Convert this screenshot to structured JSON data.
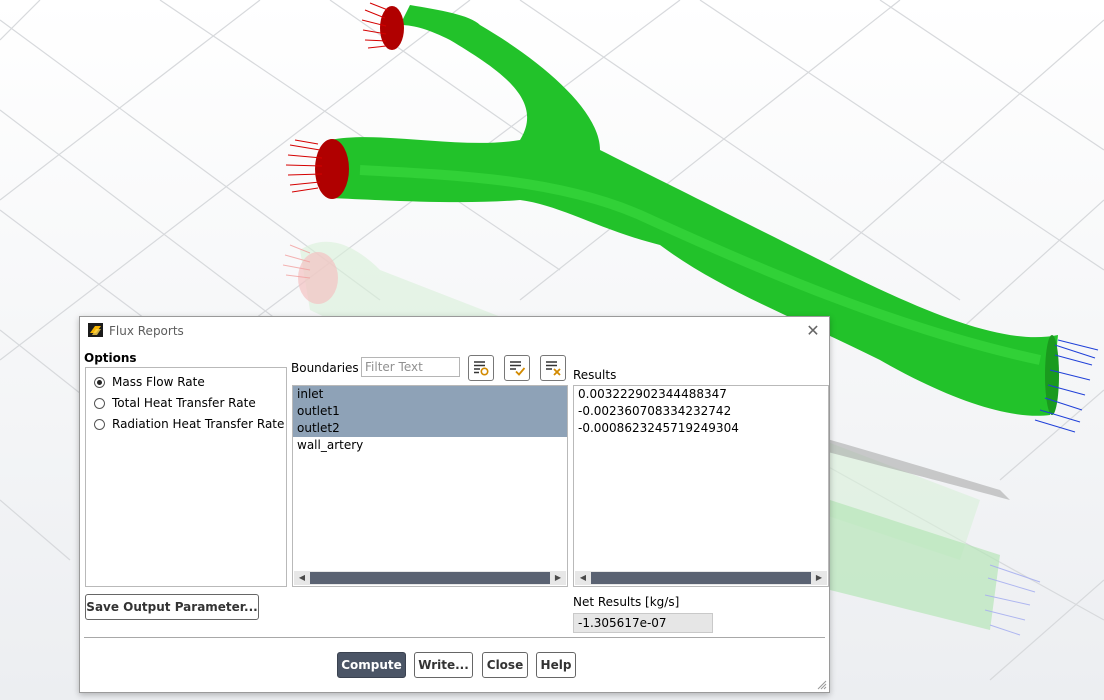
{
  "dialog": {
    "title": "Flux Reports",
    "close_glyph": "✕",
    "options": {
      "label": "Options",
      "items": [
        {
          "label": "Mass Flow Rate",
          "selected": true
        },
        {
          "label": "Total Heat Transfer Rate",
          "selected": false
        },
        {
          "label": "Radiation Heat Transfer Rate",
          "selected": false
        }
      ]
    },
    "boundaries": {
      "label": "Boundaries",
      "filter_placeholder": "Filter Text",
      "tool_icons": [
        "select-by-type-icon",
        "select-all-icon",
        "deselect-all-icon"
      ],
      "items": [
        {
          "label": "inlet",
          "selected": true
        },
        {
          "label": "outlet1",
          "selected": true
        },
        {
          "label": "outlet2",
          "selected": true
        },
        {
          "label": "wall_artery",
          "selected": false
        }
      ]
    },
    "results": {
      "label": "Results",
      "values": [
        "0.003222902344488347",
        "-0.002360708334232742",
        "-0.0008623245719249304"
      ]
    },
    "net_results": {
      "label": "Net Results [kg/s]",
      "value": "-1.305617e-07"
    },
    "buttons": {
      "save_output": "Save Output Parameter...",
      "compute": "Compute",
      "write": "Write...",
      "close": "Close",
      "help": "Help"
    }
  },
  "colors": {
    "artery": "#22c22a",
    "inlet_vectors": "#d40000",
    "outlet_vectors": "#2040d8",
    "selection": "#8ea2b7",
    "primary_button": "#4b5566"
  }
}
